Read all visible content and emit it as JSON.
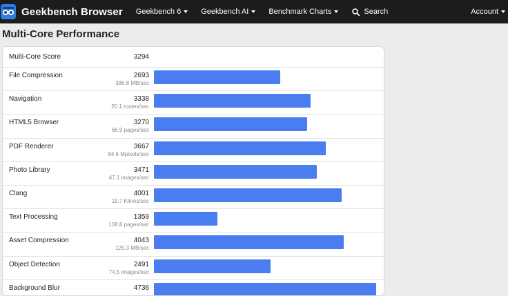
{
  "navbar": {
    "brand": "Geekbench Browser",
    "items": [
      {
        "label": "Geekbench 6"
      },
      {
        "label": "Geekbench AI"
      },
      {
        "label": "Benchmark Charts"
      }
    ],
    "search_label": "Search",
    "account_label": "Account"
  },
  "page": {
    "title": "Multi-Core Performance"
  },
  "summary": {
    "label": "Multi-Core Score",
    "score": "3294"
  },
  "benchmarks": [
    {
      "name": "File Compression",
      "score": "2693",
      "rate": "386.8 MB/sec",
      "value": 2693
    },
    {
      "name": "Navigation",
      "score": "3338",
      "rate": "20.1 routes/sec",
      "value": 3338
    },
    {
      "name": "HTML5 Browser",
      "score": "3270",
      "rate": "66.9 pages/sec",
      "value": 3270
    },
    {
      "name": "PDF Renderer",
      "score": "3667",
      "rate": "84.6 Mpixels/sec",
      "value": 3667
    },
    {
      "name": "Photo Library",
      "score": "3471",
      "rate": "47.1 images/sec",
      "value": 3471
    },
    {
      "name": "Clang",
      "score": "4001",
      "rate": "19.7 Klines/sec",
      "value": 4001
    },
    {
      "name": "Text Processing",
      "score": "1359",
      "rate": "108.8 pages/sec",
      "value": 1359
    },
    {
      "name": "Asset Compression",
      "score": "4043",
      "rate": "125.3 MB/sec",
      "value": 4043
    },
    {
      "name": "Object Detection",
      "score": "2491",
      "rate": "74.5 images/sec",
      "value": 2491
    },
    {
      "name": "Background Blur",
      "score": "4736",
      "rate": "",
      "value": 4736
    }
  ],
  "colors": {
    "bar": "#4a7df0",
    "navbar": "#1c1c1e",
    "logo": "#2f7de1"
  },
  "icons": {
    "logo": "geekbench-logo-icon",
    "search": "search-icon",
    "dropdown": "caret-down-icon"
  }
}
